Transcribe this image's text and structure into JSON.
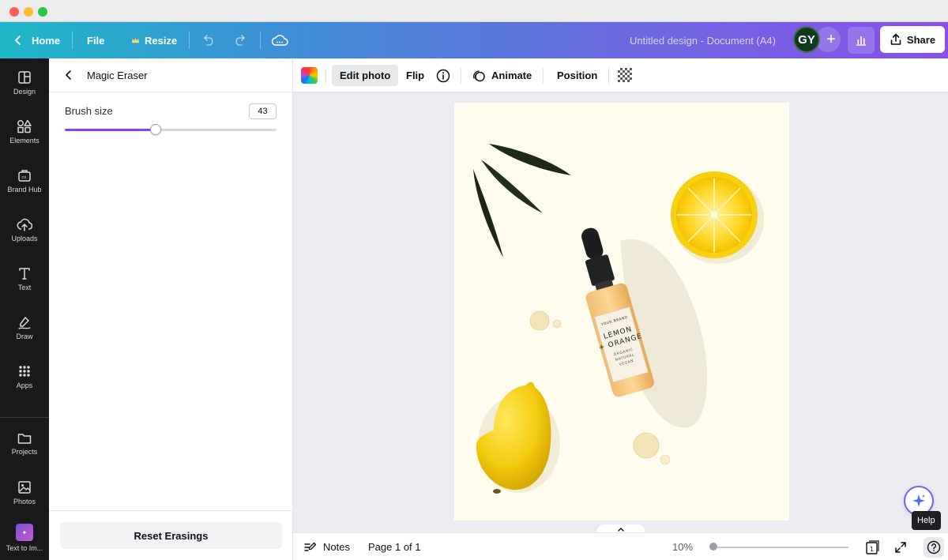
{
  "header": {
    "home_label": "Home",
    "file_label": "File",
    "resize_label": "Resize",
    "document_title": "Untitled design - Document (A4)",
    "avatar_initials": "GY",
    "share_label": "Share"
  },
  "rail": {
    "items": [
      {
        "label": "Design",
        "icon": "design-icon"
      },
      {
        "label": "Elements",
        "icon": "elements-icon"
      },
      {
        "label": "Brand Hub",
        "icon": "brand-hub-icon"
      },
      {
        "label": "Uploads",
        "icon": "uploads-icon"
      },
      {
        "label": "Text",
        "icon": "text-icon"
      },
      {
        "label": "Draw",
        "icon": "draw-icon"
      },
      {
        "label": "Apps",
        "icon": "apps-icon"
      },
      {
        "label": "Projects",
        "icon": "projects-icon"
      },
      {
        "label": "Photos",
        "icon": "photos-icon"
      },
      {
        "label": "Text to Im...",
        "icon": "text-to-image-icon"
      }
    ]
  },
  "panel": {
    "title": "Magic Eraser",
    "brush_size_label": "Brush size",
    "brush_size_value": "43",
    "brush_size_max": 100,
    "reset_label": "Reset Erasings"
  },
  "toolbar": {
    "edit_photo_label": "Edit photo",
    "flip_label": "Flip",
    "animate_label": "Animate",
    "position_label": "Position"
  },
  "canvas": {
    "bottle_label_line1": "YOUR BRAND",
    "bottle_label_line2": "LEMON",
    "bottle_label_line3": "+ ORANGE",
    "bottle_label_line4": "ORGANIC",
    "bottle_label_line5": "NATURAL",
    "bottle_label_line6": "VEGAN"
  },
  "bottom": {
    "notes_label": "Notes",
    "page_label": "Page 1 of 1",
    "zoom_label": "10%",
    "page_count": "1",
    "help_tooltip": "Help"
  },
  "colors": {
    "accent": "#8b3dff",
    "rail_bg": "#18191b",
    "canvas_bg": "#ebecf0",
    "page_bg": "#fffcee"
  }
}
